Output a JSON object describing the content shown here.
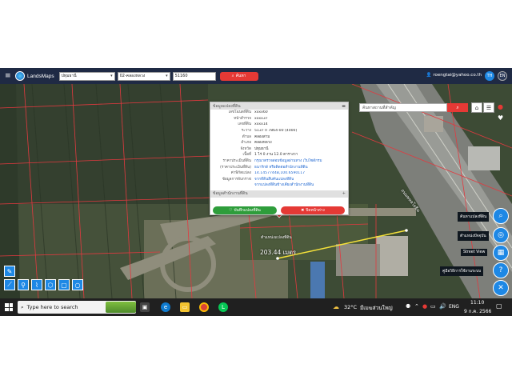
{
  "header": {
    "brand": "LandsMaps",
    "province": "ปทุมธานี",
    "district": "02-คลองหลวง",
    "parcel_no": "51160",
    "search_label": "ค้นหา",
    "user_email": "roengtai@yahoo.co.th",
    "lang_th": "TH",
    "lang_en": "EN"
  },
  "address_search": {
    "placeholder": "ค้นหาสถานที่สำคัญ"
  },
  "popup": {
    "title": "ข้อมูลแปลงที่ดิน",
    "rows": [
      {
        "k": "เลขโฉนดที่ดิน",
        "v": "xxxx60"
      },
      {
        "k": "หน้าสำรวจ",
        "v": "xxxx37"
      },
      {
        "k": "เลขที่ดิน",
        "v": "xxxx14"
      },
      {
        "k": "ระวาง",
        "v": "5137 II 7864-00 (4000)"
      },
      {
        "k": "ตำบล",
        "v": "คลองสาม"
      },
      {
        "k": "อำเภอ",
        "v": "คลองหลวง"
      },
      {
        "k": "จังหวัด",
        "v": "ปทุมธานี"
      },
      {
        "k": "เนื้อที่",
        "v": "1 ไร่ 0 งาน 12.0 ตารางวา"
      },
      {
        "k": "ราคาประเมินที่ดิน",
        "v": "กรุณาตรวจสอบข้อมูลผ่านทาง เว็บไซต์กรม"
      },
      {
        "k": "(ราคาประเมินที่ดิน)",
        "v": "ธนารักษ์ หรือติดต่อสำนักงานที่ดิน"
      },
      {
        "k": "ค่าพิกัดแปลง",
        "v": "14.1457744B,100.6590117"
      },
      {
        "k": "ข้อมูลการจับกราฟ",
        "v": "จากที่ดินสืบค้นแปลงที่ดิน"
      },
      {
        "k": "",
        "v": "จากแปลงที่ดินข้างเคียงสำนักงานที่ดิน"
      }
    ],
    "section2": "ข้อมูลสำนักงานที่ดิน",
    "save_label": "บันทึกแปลงที่ดิน",
    "close_label": "ปิดหน้าต่าง"
  },
  "map": {
    "pin_label": "ตำแหน่งแปลงที่ดิน",
    "distance": "203.44 เมตร",
    "road_label": "ถนนพหลโยธิน"
  },
  "right_tips": {
    "search_parcel": "ค้นหาแปลงที่ดิน",
    "my_location": "ตำแหน่งปัจจุบัน",
    "street_view": "Street View",
    "manual": "คู่มือวิธีการใช้งานระบบ"
  },
  "taskbar": {
    "search_placeholder": "Type here to search",
    "weather": "32°C",
    "weather_desc": "มีเมฆส่วนใหญ่",
    "lang": "ENG",
    "time": "11:10",
    "date": "9 ก.ค. 2566"
  },
  "colors": {
    "accent": "#1e88e5",
    "danger": "#e53935",
    "save": "#2e9d3b",
    "header": "#1f2a44"
  }
}
